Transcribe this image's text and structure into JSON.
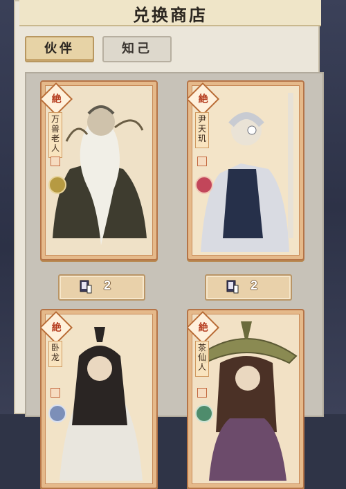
{
  "title": "兑换商店",
  "tabs": [
    {
      "label": "伙伴",
      "active": true
    },
    {
      "label": "知己",
      "active": false
    }
  ],
  "cards": [
    {
      "rank": "絶",
      "name": "万兽老人",
      "cost": "2",
      "orb_color": "#b69a42"
    },
    {
      "rank": "絶",
      "name": "尹天玑",
      "cost": "2",
      "orb_color": "#c2465a"
    },
    {
      "rank": "絶",
      "name": "卧龙",
      "cost": "",
      "orb_color": "#7c8fb8"
    },
    {
      "rank": "絶",
      "name": "茶仙人",
      "cost": "",
      "orb_color": "#4e8c6c"
    }
  ],
  "colors": {
    "panel": "#ebe6da",
    "card_frame": "#b57447",
    "rank_text": "#b43a1c"
  },
  "icons": [
    "exchange-book-icon",
    "rank-badge-icon"
  ]
}
